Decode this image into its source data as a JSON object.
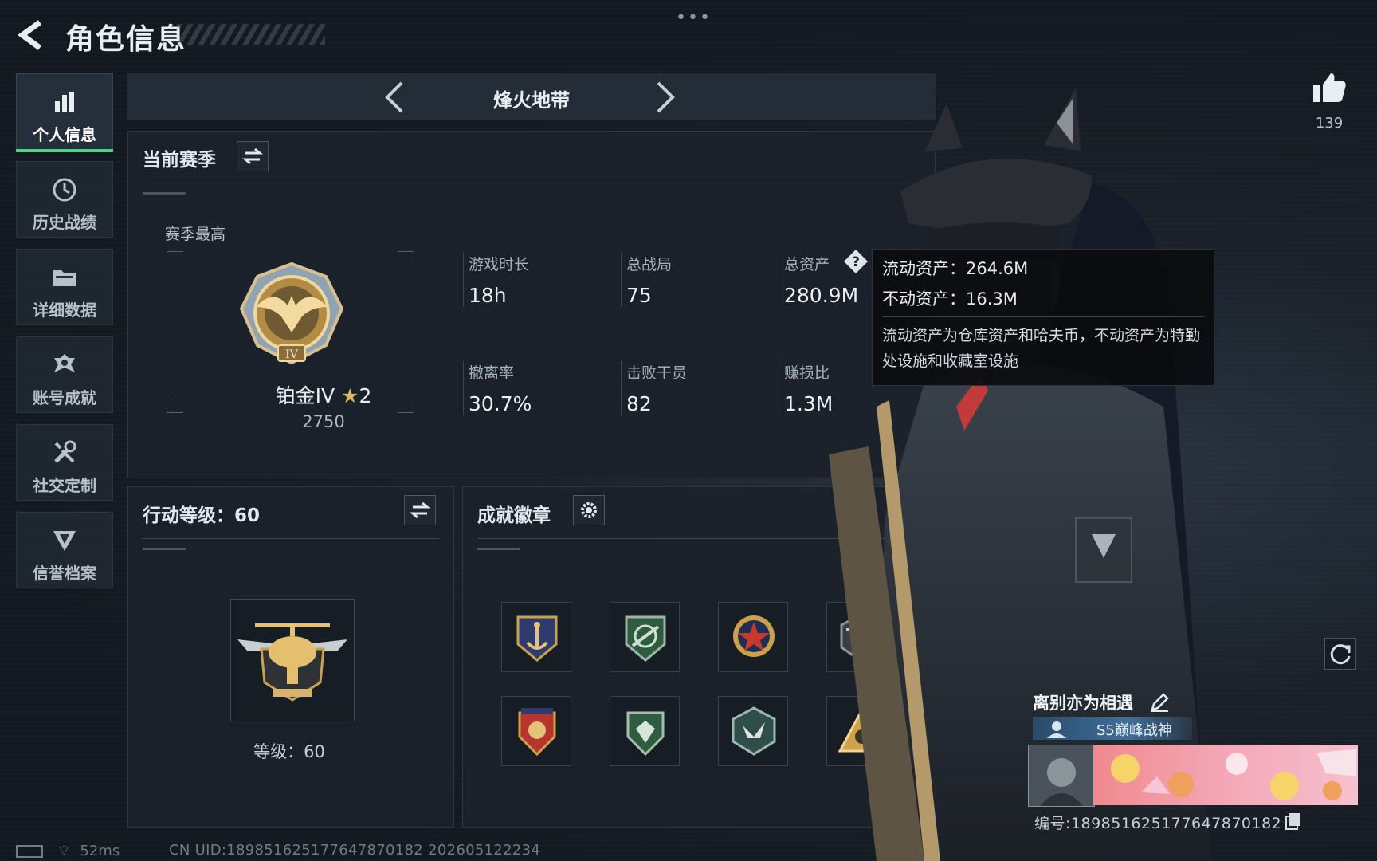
{
  "header": {
    "title": "角色信息"
  },
  "sidebar": {
    "items": [
      {
        "label": "个人信息",
        "icon": "bar-chart-icon",
        "active": true
      },
      {
        "label": "历史战绩",
        "icon": "history-icon"
      },
      {
        "label": "详细数据",
        "icon": "folder-icon"
      },
      {
        "label": "账号成就",
        "icon": "achievement-icon"
      },
      {
        "label": "社交定制",
        "icon": "tools-icon"
      },
      {
        "label": "信誉档案",
        "icon": "shield-icon"
      }
    ]
  },
  "mode": {
    "title": "烽火地带"
  },
  "season": {
    "heading": "当前赛季",
    "best_label": "赛季最高",
    "rank_name": "铂金IV",
    "rank_stars": "2",
    "rank_score": "2750",
    "stats": [
      {
        "label": "游戏时长",
        "value": "18h"
      },
      {
        "label": "总战局",
        "value": "75"
      },
      {
        "label": "总资产",
        "value": "280.9M"
      },
      {
        "label": "撤离率",
        "value": "30.7%"
      },
      {
        "label": "击败干员",
        "value": "82"
      },
      {
        "label": "赚损比",
        "value": "1.3M"
      }
    ]
  },
  "tooltip": {
    "liquid": "流动资产：264.6M",
    "fixed": "不动资产：16.3M",
    "desc": "流动资产为仓库资产和哈夫币，不动资产为特勤处设施和收藏室设施"
  },
  "action_level": {
    "heading": "行动等级：60",
    "level_text": "等级：60"
  },
  "achievements": {
    "heading": "成就徽章",
    "medals": [
      {
        "icon": "navy-anchor-medal-icon",
        "color": "#c9a24a"
      },
      {
        "icon": "green-rifle-medal-icon",
        "color": "#3f7d58"
      },
      {
        "icon": "red-star-medal-icon",
        "color": "#c63a2e"
      },
      {
        "icon": "helicopter-medal-icon",
        "color": "#6b6f72"
      },
      {
        "icon": "red-shield-medal-icon",
        "color": "#b8342f"
      },
      {
        "icon": "green-shield-medal-icon",
        "color": "#3f7d58"
      },
      {
        "icon": "wolf-hex-medal-icon",
        "color": "#4f8075"
      },
      {
        "icon": "gold-triangle-medal-icon",
        "color": "#d1a24a"
      }
    ]
  },
  "social": {
    "likes": "139"
  },
  "player": {
    "name": "离别亦为相遇",
    "title_tag": "S5巅峰战神",
    "code": "编号:18985162517764787018​2"
  },
  "footer": {
    "ping": "52ms",
    "uid": "CN UID:18985162517764787018​2 202605122234"
  },
  "colors": {
    "accent_green": "#4fd08a",
    "panel_bg": "#1b222b",
    "gold": "#c9a24a"
  }
}
